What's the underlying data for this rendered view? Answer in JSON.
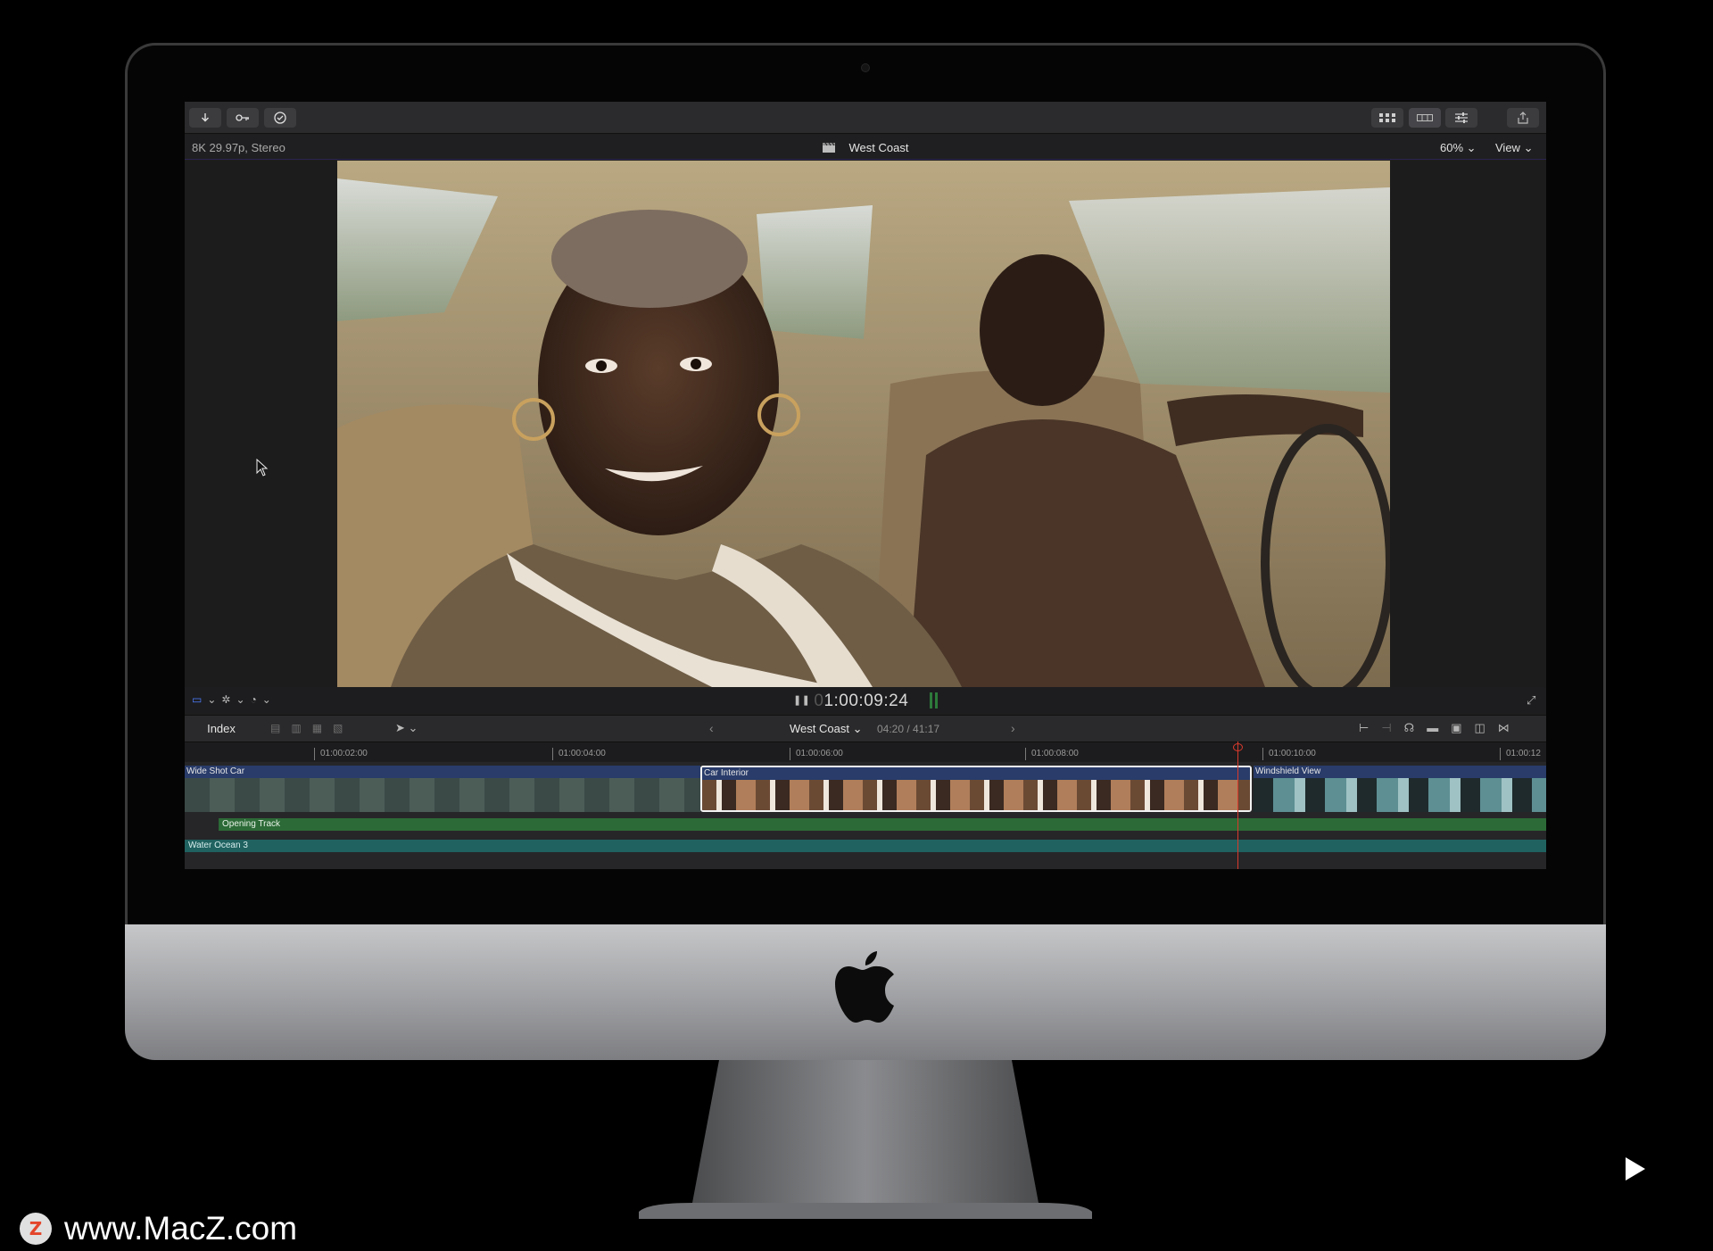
{
  "toolbar": {
    "left_buttons": [
      "import-icon",
      "keyword-icon",
      "background-tasks-icon"
    ],
    "right_buttons": [
      "browser-view-icon",
      "timeline-view-icon",
      "inspector-icon",
      "share-icon"
    ]
  },
  "viewer_header": {
    "format": "8K 29.97p, Stereo",
    "title": "West Coast",
    "zoom": "60%",
    "view": "View"
  },
  "viewer_controls": {
    "timecode_dim": "0",
    "timecode": "1:00:09:24"
  },
  "timeline_bar": {
    "index_label": "Index",
    "project_name": "West Coast",
    "project_duration": "04:20 / 41:17"
  },
  "ruler": {
    "ticks": [
      "01:00:02:00",
      "01:00:04:00",
      "01:00:06:00",
      "01:00:08:00",
      "01:00:10:00",
      "01:00:12"
    ]
  },
  "clips": {
    "wide": "Wide Shot Car",
    "car": "Car Interior",
    "windshield": "Windshield View"
  },
  "audio": {
    "opening": "Opening Track",
    "water": "Water Ocean 3"
  },
  "watermark": {
    "logo_letter": "Z",
    "text": "www.MacZ.com"
  },
  "colors": {
    "playhead": "#d93a2c",
    "clip_header": "#293c6a",
    "opening_track": "#2c6a37",
    "water_track": "#1f6260"
  }
}
